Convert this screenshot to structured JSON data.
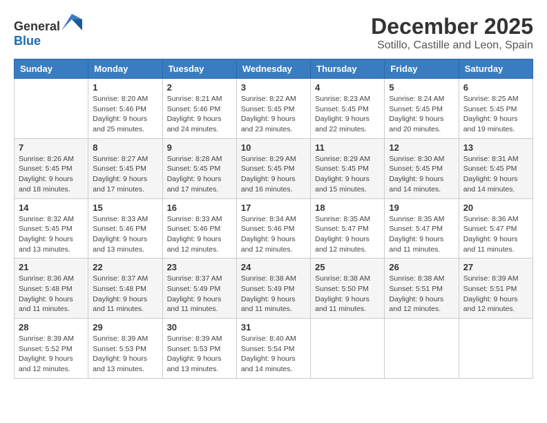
{
  "logo": {
    "text_general": "General",
    "text_blue": "Blue"
  },
  "title": "December 2025",
  "subtitle": "Sotillo, Castille and Leon, Spain",
  "weekdays": [
    "Sunday",
    "Monday",
    "Tuesday",
    "Wednesday",
    "Thursday",
    "Friday",
    "Saturday"
  ],
  "weeks": [
    [
      {
        "day": "",
        "sunrise": "",
        "sunset": "",
        "daylight": ""
      },
      {
        "day": "1",
        "sunrise": "Sunrise: 8:20 AM",
        "sunset": "Sunset: 5:46 PM",
        "daylight": "Daylight: 9 hours and 25 minutes."
      },
      {
        "day": "2",
        "sunrise": "Sunrise: 8:21 AM",
        "sunset": "Sunset: 5:46 PM",
        "daylight": "Daylight: 9 hours and 24 minutes."
      },
      {
        "day": "3",
        "sunrise": "Sunrise: 8:22 AM",
        "sunset": "Sunset: 5:45 PM",
        "daylight": "Daylight: 9 hours and 23 minutes."
      },
      {
        "day": "4",
        "sunrise": "Sunrise: 8:23 AM",
        "sunset": "Sunset: 5:45 PM",
        "daylight": "Daylight: 9 hours and 22 minutes."
      },
      {
        "day": "5",
        "sunrise": "Sunrise: 8:24 AM",
        "sunset": "Sunset: 5:45 PM",
        "daylight": "Daylight: 9 hours and 20 minutes."
      },
      {
        "day": "6",
        "sunrise": "Sunrise: 8:25 AM",
        "sunset": "Sunset: 5:45 PM",
        "daylight": "Daylight: 9 hours and 19 minutes."
      }
    ],
    [
      {
        "day": "7",
        "sunrise": "Sunrise: 8:26 AM",
        "sunset": "Sunset: 5:45 PM",
        "daylight": "Daylight: 9 hours and 18 minutes."
      },
      {
        "day": "8",
        "sunrise": "Sunrise: 8:27 AM",
        "sunset": "Sunset: 5:45 PM",
        "daylight": "Daylight: 9 hours and 17 minutes."
      },
      {
        "day": "9",
        "sunrise": "Sunrise: 8:28 AM",
        "sunset": "Sunset: 5:45 PM",
        "daylight": "Daylight: 9 hours and 17 minutes."
      },
      {
        "day": "10",
        "sunrise": "Sunrise: 8:29 AM",
        "sunset": "Sunset: 5:45 PM",
        "daylight": "Daylight: 9 hours and 16 minutes."
      },
      {
        "day": "11",
        "sunrise": "Sunrise: 8:29 AM",
        "sunset": "Sunset: 5:45 PM",
        "daylight": "Daylight: 9 hours and 15 minutes."
      },
      {
        "day": "12",
        "sunrise": "Sunrise: 8:30 AM",
        "sunset": "Sunset: 5:45 PM",
        "daylight": "Daylight: 9 hours and 14 minutes."
      },
      {
        "day": "13",
        "sunrise": "Sunrise: 8:31 AM",
        "sunset": "Sunset: 5:45 PM",
        "daylight": "Daylight: 9 hours and 14 minutes."
      }
    ],
    [
      {
        "day": "14",
        "sunrise": "Sunrise: 8:32 AM",
        "sunset": "Sunset: 5:45 PM",
        "daylight": "Daylight: 9 hours and 13 minutes."
      },
      {
        "day": "15",
        "sunrise": "Sunrise: 8:33 AM",
        "sunset": "Sunset: 5:46 PM",
        "daylight": "Daylight: 9 hours and 13 minutes."
      },
      {
        "day": "16",
        "sunrise": "Sunrise: 8:33 AM",
        "sunset": "Sunset: 5:46 PM",
        "daylight": "Daylight: 9 hours and 12 minutes."
      },
      {
        "day": "17",
        "sunrise": "Sunrise: 8:34 AM",
        "sunset": "Sunset: 5:46 PM",
        "daylight": "Daylight: 9 hours and 12 minutes."
      },
      {
        "day": "18",
        "sunrise": "Sunrise: 8:35 AM",
        "sunset": "Sunset: 5:47 PM",
        "daylight": "Daylight: 9 hours and 12 minutes."
      },
      {
        "day": "19",
        "sunrise": "Sunrise: 8:35 AM",
        "sunset": "Sunset: 5:47 PM",
        "daylight": "Daylight: 9 hours and 11 minutes."
      },
      {
        "day": "20",
        "sunrise": "Sunrise: 8:36 AM",
        "sunset": "Sunset: 5:47 PM",
        "daylight": "Daylight: 9 hours and 11 minutes."
      }
    ],
    [
      {
        "day": "21",
        "sunrise": "Sunrise: 8:36 AM",
        "sunset": "Sunset: 5:48 PM",
        "daylight": "Daylight: 9 hours and 11 minutes."
      },
      {
        "day": "22",
        "sunrise": "Sunrise: 8:37 AM",
        "sunset": "Sunset: 5:48 PM",
        "daylight": "Daylight: 9 hours and 11 minutes."
      },
      {
        "day": "23",
        "sunrise": "Sunrise: 8:37 AM",
        "sunset": "Sunset: 5:49 PM",
        "daylight": "Daylight: 9 hours and 11 minutes."
      },
      {
        "day": "24",
        "sunrise": "Sunrise: 8:38 AM",
        "sunset": "Sunset: 5:49 PM",
        "daylight": "Daylight: 9 hours and 11 minutes."
      },
      {
        "day": "25",
        "sunrise": "Sunrise: 8:38 AM",
        "sunset": "Sunset: 5:50 PM",
        "daylight": "Daylight: 9 hours and 11 minutes."
      },
      {
        "day": "26",
        "sunrise": "Sunrise: 8:38 AM",
        "sunset": "Sunset: 5:51 PM",
        "daylight": "Daylight: 9 hours and 12 minutes."
      },
      {
        "day": "27",
        "sunrise": "Sunrise: 8:39 AM",
        "sunset": "Sunset: 5:51 PM",
        "daylight": "Daylight: 9 hours and 12 minutes."
      }
    ],
    [
      {
        "day": "28",
        "sunrise": "Sunrise: 8:39 AM",
        "sunset": "Sunset: 5:52 PM",
        "daylight": "Daylight: 9 hours and 12 minutes."
      },
      {
        "day": "29",
        "sunrise": "Sunrise: 8:39 AM",
        "sunset": "Sunset: 5:53 PM",
        "daylight": "Daylight: 9 hours and 13 minutes."
      },
      {
        "day": "30",
        "sunrise": "Sunrise: 8:39 AM",
        "sunset": "Sunset: 5:53 PM",
        "daylight": "Daylight: 9 hours and 13 minutes."
      },
      {
        "day": "31",
        "sunrise": "Sunrise: 8:40 AM",
        "sunset": "Sunset: 5:54 PM",
        "daylight": "Daylight: 9 hours and 14 minutes."
      },
      {
        "day": "",
        "sunrise": "",
        "sunset": "",
        "daylight": ""
      },
      {
        "day": "",
        "sunrise": "",
        "sunset": "",
        "daylight": ""
      },
      {
        "day": "",
        "sunrise": "",
        "sunset": "",
        "daylight": ""
      }
    ]
  ]
}
